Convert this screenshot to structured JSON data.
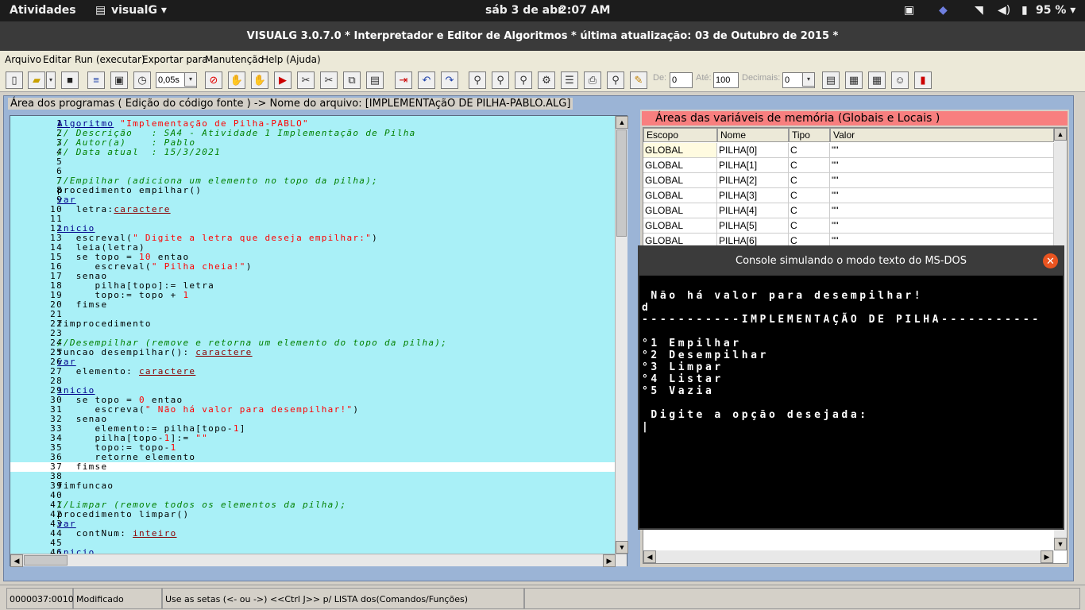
{
  "topbar": {
    "activities": "Atividades",
    "app_name": "visualG ▾",
    "date": "sáb 3 de abr",
    "time": "2:07 AM",
    "battery": "95 % ▾"
  },
  "window_title": "VISUALG 3.0.7.0 * Interpretador e Editor de Algoritmos * última atualização: 03 de Outubro de 2015 *",
  "menu": [
    "Arquivo",
    "Editar",
    "Run (executar)",
    "Exportar para",
    "Manutenção",
    "Help (Ajuda)"
  ],
  "toolbar": {
    "speed": "0,05s",
    "de_label": "De:",
    "de_value": "0",
    "ate_label": "Até:",
    "ate_value": "100",
    "decimais_label": "Decimais:",
    "decimais_value": "0"
  },
  "program_area_title": "Área dos programas ( Edição do código fonte ) -> Nome do arquivo: [IMPLEMENTAçãO DE PILHA-PABLO.ALG]",
  "code_lines": [
    [
      [
        "kw",
        "Algoritmo"
      ],
      [
        "t",
        " "
      ],
      [
        "st",
        "\"Implementação de Pilha-PABLO\""
      ]
    ],
    [
      [
        "cm",
        "// Descrição   : SA4 - Atividade 1 Implementação de Pilha"
      ]
    ],
    [
      [
        "cm",
        "// Autor(a)    : Pablo"
      ]
    ],
    [
      [
        "cm",
        "// Data atual  : 15/3/2021"
      ]
    ],
    [],
    [],
    [
      [
        "cm",
        "//Empilhar (adiciona um elemento no topo da pilha);"
      ]
    ],
    [
      [
        "t",
        "procedimento empilhar()"
      ]
    ],
    [
      [
        "kw",
        "var"
      ]
    ],
    [
      [
        "t",
        "   letra:"
      ],
      [
        "ty",
        "caractere"
      ]
    ],
    [],
    [
      [
        "kw",
        "inicio"
      ]
    ],
    [
      [
        "t",
        "   escreval("
      ],
      [
        "st",
        "\" Digite a letra que deseja empilhar:\""
      ],
      [
        "t",
        ")"
      ]
    ],
    [
      [
        "t",
        "   leia(letra)"
      ]
    ],
    [
      [
        "t",
        "   se topo = "
      ],
      [
        "nu",
        "10"
      ],
      [
        "t",
        " entao"
      ]
    ],
    [
      [
        "t",
        "      escreval("
      ],
      [
        "st",
        "\" Pilha cheia!\""
      ],
      [
        "t",
        ")"
      ]
    ],
    [
      [
        "t",
        "   senao"
      ]
    ],
    [
      [
        "t",
        "      pilha[topo]:= letra"
      ]
    ],
    [
      [
        "t",
        "      topo:= topo + "
      ],
      [
        "nu",
        "1"
      ]
    ],
    [
      [
        "t",
        "   fimse"
      ]
    ],
    [],
    [
      [
        "t",
        "fimprocedimento"
      ]
    ],
    [],
    [
      [
        "cm",
        "//Desempilhar (remove e retorna um elemento do topo da pilha);"
      ]
    ],
    [
      [
        "t",
        "funcao desempilhar(): "
      ],
      [
        "ty",
        "caractere"
      ]
    ],
    [
      [
        "kw",
        "var"
      ]
    ],
    [
      [
        "t",
        "   elemento: "
      ],
      [
        "ty",
        "caractere"
      ]
    ],
    [],
    [
      [
        "kw",
        "inicio"
      ]
    ],
    [
      [
        "t",
        "   se topo = "
      ],
      [
        "nu",
        "0"
      ],
      [
        "t",
        " entao"
      ]
    ],
    [
      [
        "t",
        "      escreva("
      ],
      [
        "st",
        "\" Não há valor para desempilhar!\""
      ],
      [
        "t",
        ")"
      ]
    ],
    [
      [
        "t",
        "   senao"
      ]
    ],
    [
      [
        "t",
        "      elemento:= pilha[topo-"
      ],
      [
        "nu",
        "1"
      ],
      [
        "t",
        "]"
      ]
    ],
    [
      [
        "t",
        "      pilha[topo-"
      ],
      [
        "nu",
        "1"
      ],
      [
        "t",
        "]:= "
      ],
      [
        "st",
        "\"\""
      ]
    ],
    [
      [
        "t",
        "      topo:= topo-"
      ],
      [
        "nu",
        "1"
      ]
    ],
    [
      [
        "t",
        "      retorne elemento"
      ]
    ],
    [
      [
        "t",
        "   fimse"
      ]
    ],
    [],
    [
      [
        "t",
        "fimfuncao"
      ]
    ],
    [],
    [
      [
        "cm",
        "//Limpar (remove todos os elementos da pilha);"
      ]
    ],
    [
      [
        "t",
        "procedimento limpar()"
      ]
    ],
    [
      [
        "kw",
        "var"
      ]
    ],
    [
      [
        "t",
        "   contNum: "
      ],
      [
        "ty",
        "inteiro"
      ]
    ],
    [],
    [
      [
        "kw",
        "inicio"
      ]
    ]
  ],
  "highlight_line": 37,
  "variables": {
    "title": "Áreas das variáveis de memória (Globais e Locais )",
    "columns": [
      "Escopo",
      "Nome",
      "Tipo",
      "Valor"
    ],
    "rows": [
      [
        "GLOBAL",
        "PILHA[0]",
        "C",
        "\"\""
      ],
      [
        "GLOBAL",
        "PILHA[1]",
        "C",
        "\"\""
      ],
      [
        "GLOBAL",
        "PILHA[2]",
        "C",
        "\"\""
      ],
      [
        "GLOBAL",
        "PILHA[3]",
        "C",
        "\"\""
      ],
      [
        "GLOBAL",
        "PILHA[4]",
        "C",
        "\"\""
      ],
      [
        "GLOBAL",
        "PILHA[5]",
        "C",
        "\"\""
      ],
      [
        "GLOBAL",
        "PILHA[6]",
        "C",
        "\"\""
      ]
    ]
  },
  "console": {
    "title": "Console simulando o modo texto do MS-DOS",
    "lines": [
      " Não há valor para desempilhar!",
      "d",
      "-----------IMPLEMENTAÇÃO DE PILHA-----------",
      "",
      "°1 Empilhar",
      "°2 Desempilhar",
      "°3 Limpar",
      "°4 Listar",
      "°5 Vazia",
      "",
      " Digite a opção desejada:",
      "|"
    ]
  },
  "status": {
    "position": "0000037:0010",
    "state": "Modificado",
    "hint": "Use as setas (<- ou ->) <<Ctrl J>> p/ LISTA dos(Comandos/Funções)"
  }
}
